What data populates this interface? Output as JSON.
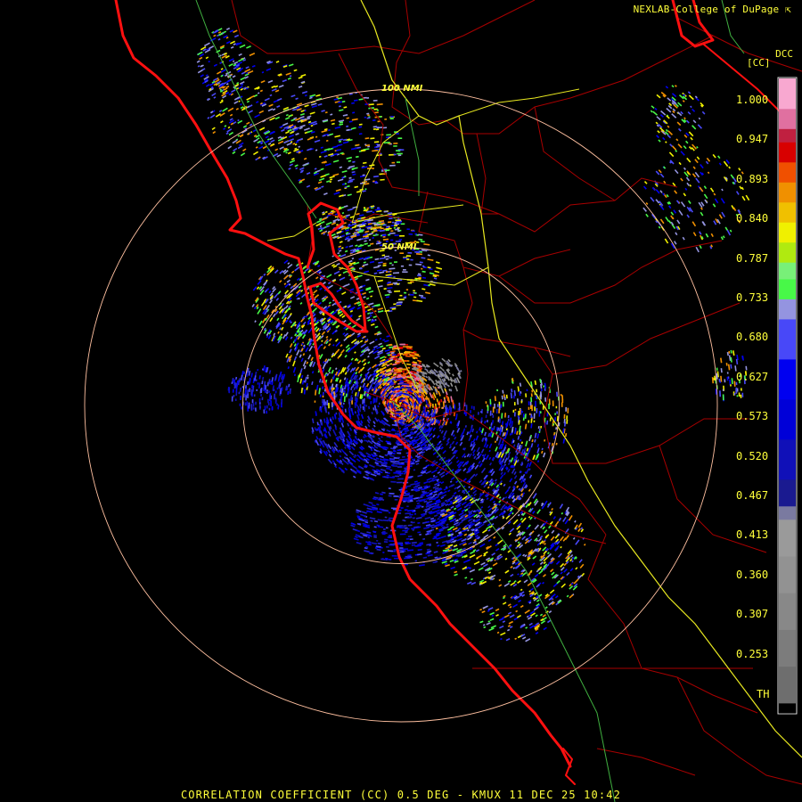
{
  "header": {
    "credit": "NEXLAB-College of DuPage",
    "credit_symbol": "⇱"
  },
  "legend": {
    "title": "DCC",
    "unit": "[CC]",
    "ticks": [
      "1.000",
      "0.947",
      "0.893",
      "0.840",
      "0.787",
      "0.733",
      "0.680",
      "0.627",
      "0.573",
      "0.520",
      "0.467",
      "0.413",
      "0.360",
      "0.307",
      "0.253"
    ],
    "threshold_label": "TH",
    "colors": [
      "#000000",
      "#6e6e6e",
      "#7c7c7c",
      "#888888",
      "#929292",
      "#9a9a9a",
      "#7a7aa0",
      "#1a1a90",
      "#1010b8",
      "#0000d8",
      "#0000f0",
      "#4848f8",
      "#9494e0",
      "#48f848",
      "#78f078",
      "#b0ea10",
      "#f0f000",
      "#f0c000",
      "#f09000",
      "#f05000",
      "#d80000",
      "#c02040",
      "#e070a0",
      "#f8a8d0"
    ]
  },
  "range_rings": [
    {
      "label": "50 NMI",
      "nmi": 50
    },
    {
      "label": "100 NMI",
      "nmi": 100
    }
  ],
  "caption": "CORRELATION COEFFICIENT (CC) 0.5 DEG - KMUX 11 DEC 25 10:42",
  "colors": {
    "annotation": "#ffff3a",
    "range_ring": "#ffc0a0",
    "coastline": "#ff1010",
    "county_border": "#b00000",
    "highway": "#e8e820",
    "state_road": "#40b040"
  }
}
